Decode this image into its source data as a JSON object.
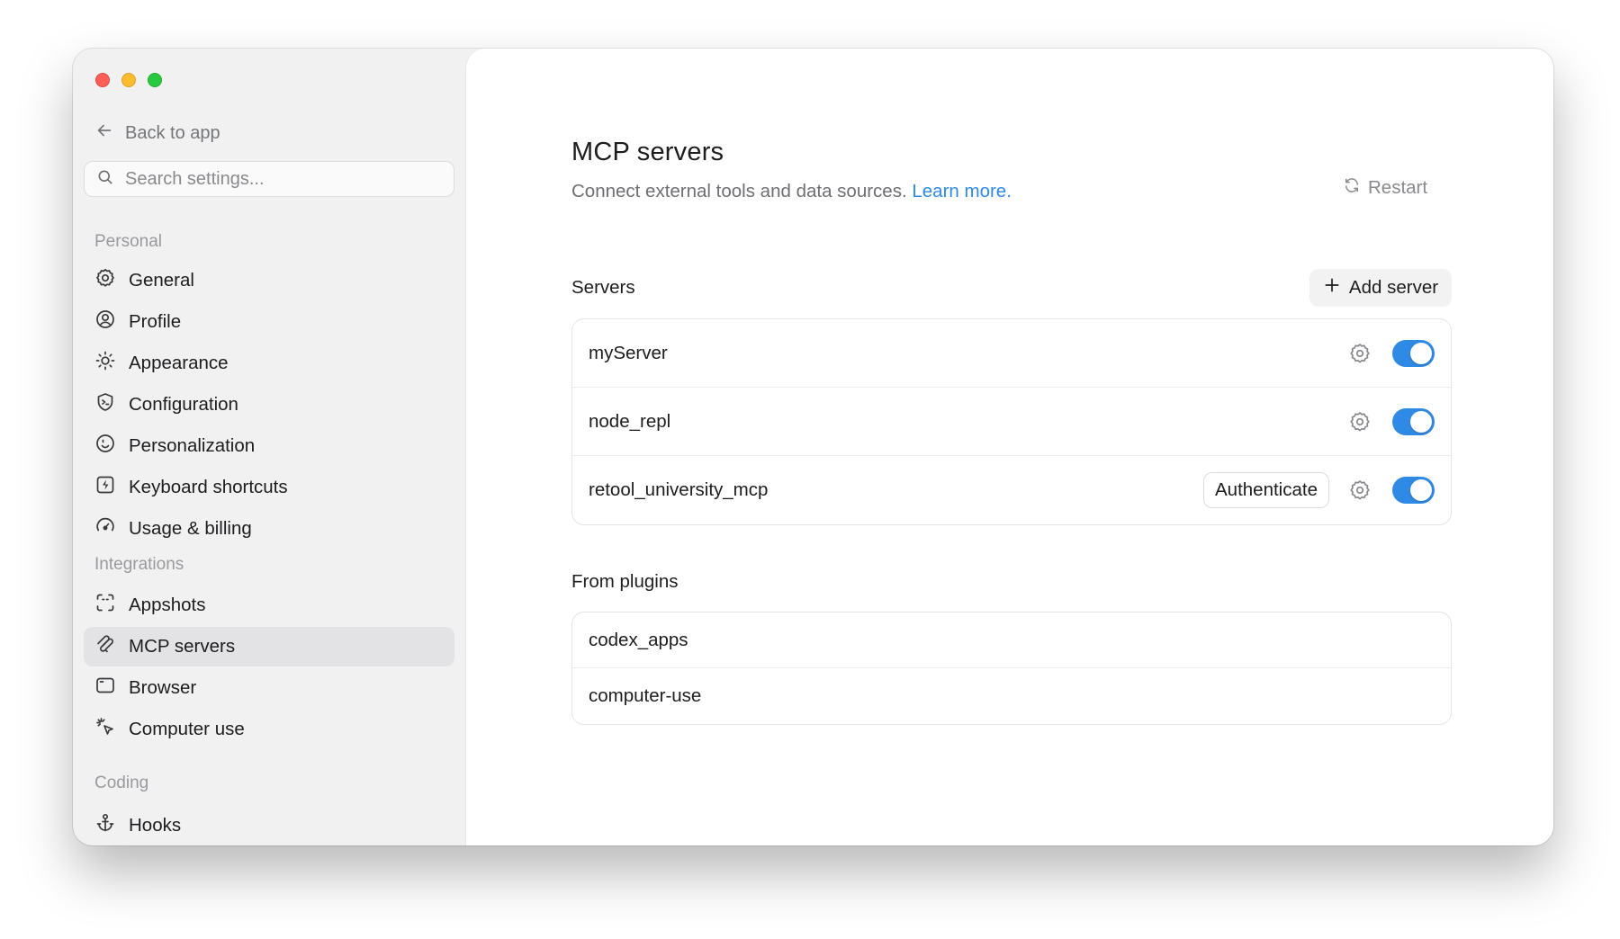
{
  "sidebar": {
    "back_label": "Back to app",
    "search_placeholder": "Search settings...",
    "sections": [
      {
        "label": "Personal",
        "items": [
          {
            "label": "General",
            "icon": "gear-icon"
          },
          {
            "label": "Profile",
            "icon": "user-circle-icon"
          },
          {
            "label": "Appearance",
            "icon": "sun-icon"
          },
          {
            "label": "Configuration",
            "icon": "shield-terminal-icon"
          },
          {
            "label": "Personalization",
            "icon": "smile-icon"
          },
          {
            "label": "Keyboard shortcuts",
            "icon": "keyboard-bolt-icon"
          },
          {
            "label": "Usage & billing",
            "icon": "gauge-icon"
          }
        ]
      },
      {
        "label": "Integrations",
        "items": [
          {
            "label": "Appshots",
            "icon": "screenshot-frame-icon"
          },
          {
            "label": "MCP servers",
            "icon": "mcp-icon",
            "active": true
          },
          {
            "label": "Browser",
            "icon": "browser-window-icon"
          },
          {
            "label": "Computer use",
            "icon": "cursor-click-icon"
          }
        ]
      },
      {
        "label": "Coding",
        "items": [
          {
            "label": "Hooks",
            "icon": "anchor-icon"
          }
        ]
      }
    ]
  },
  "main": {
    "title": "MCP servers",
    "subtitle": "Connect external tools and data sources.",
    "learn_more": "Learn more.",
    "restart_label": "Restart",
    "servers_heading": "Servers",
    "add_server_label": "Add server",
    "servers": [
      {
        "name": "myServer",
        "enabled": true
      },
      {
        "name": "node_repl",
        "enabled": true
      },
      {
        "name": "retool_university_mcp",
        "enabled": true,
        "action": "Authenticate"
      }
    ],
    "plugins_heading": "From plugins",
    "plugins": [
      {
        "name": "codex_apps"
      },
      {
        "name": "computer-use"
      }
    ]
  },
  "colors": {
    "accent": "#2f8ae6",
    "sidebar_bg": "#f1f1f2",
    "active_item_bg": "#e3e3e6"
  }
}
